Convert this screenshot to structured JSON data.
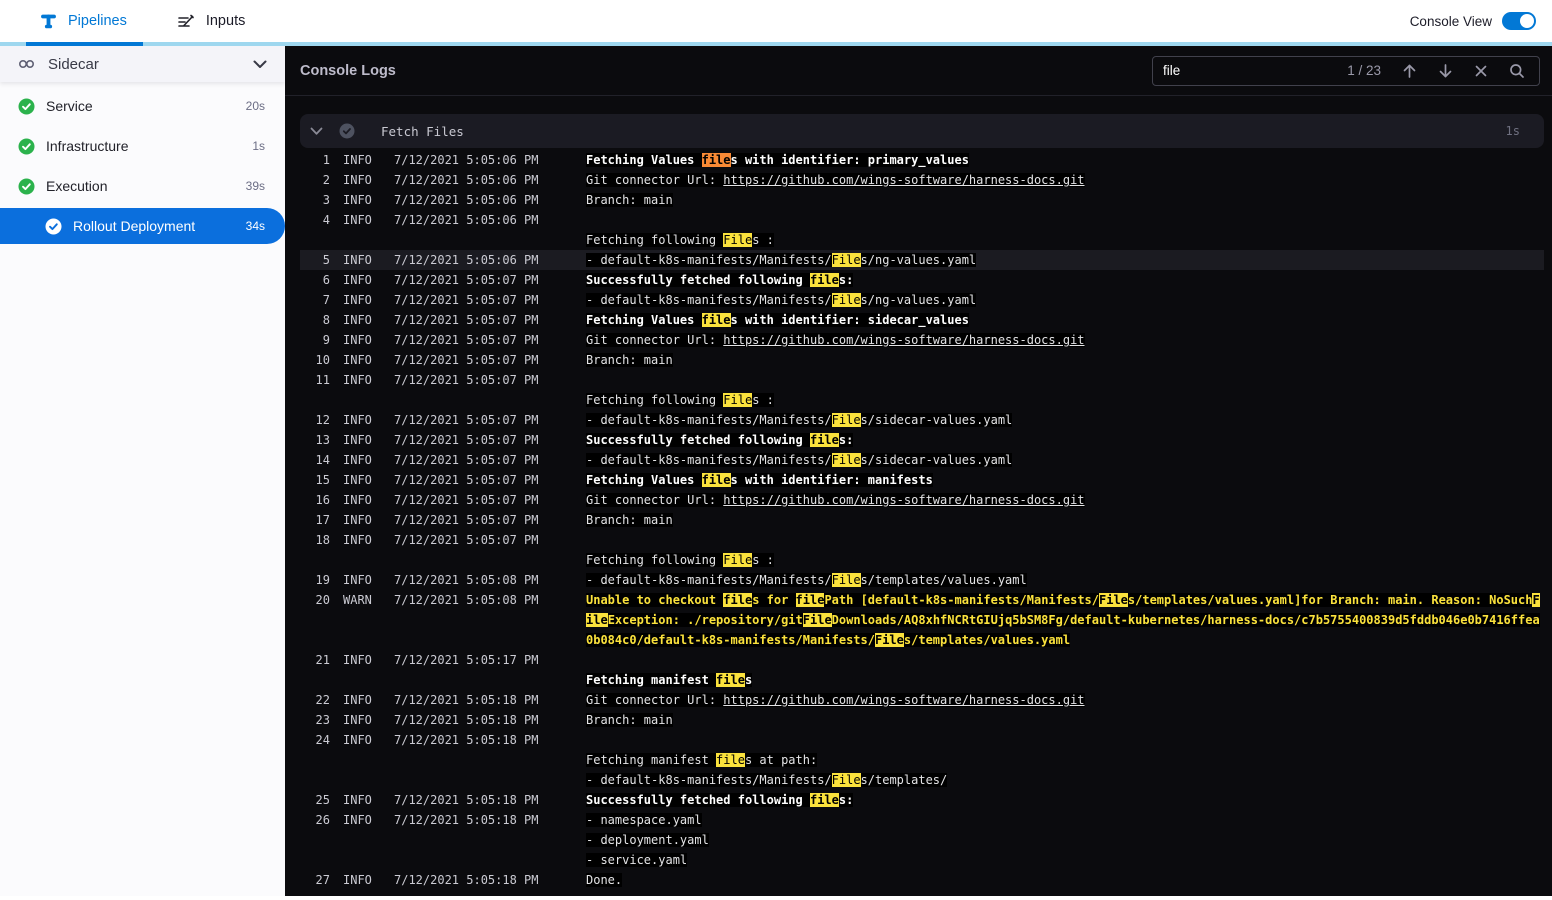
{
  "topbar": {
    "tabs": [
      {
        "label": "Pipelines",
        "active": true
      },
      {
        "label": "Inputs",
        "active": false
      }
    ],
    "console_view_label": "Console View",
    "console_view_on": true
  },
  "sidebar": {
    "stage_label": "Sidecar",
    "steps": [
      {
        "label": "Service",
        "duration": "20s",
        "status": "success",
        "selected": false
      },
      {
        "label": "Infrastructure",
        "duration": "1s",
        "status": "success",
        "selected": false
      },
      {
        "label": "Execution",
        "duration": "39s",
        "status": "success",
        "selected": false
      },
      {
        "label": "Rollout Deployment",
        "duration": "34s",
        "status": "success",
        "selected": true
      }
    ]
  },
  "console": {
    "title": "Console Logs",
    "search": {
      "value": "file",
      "counter": "1 / 23",
      "icons": [
        "arrow-up-icon",
        "arrow-down-icon",
        "close-icon",
        "search-icon"
      ]
    },
    "section": {
      "title": "Fetch Files",
      "duration": "1s"
    },
    "rows": [
      {
        "num": "1",
        "level": "INFO",
        "time": "7/12/2021 5:05:06 PM",
        "bold": true,
        "segs": [
          {
            "t": "Fetching Values "
          },
          {
            "t": "file",
            "h": "o"
          },
          {
            "t": "s with identifier: primary_values"
          }
        ]
      },
      {
        "num": "2",
        "level": "INFO",
        "time": "7/12/2021 5:05:06 PM",
        "segs": [
          {
            "t": "Git connector Url: "
          },
          {
            "t": "https://github.com/wings-software/harness-docs.git",
            "link": true
          }
        ]
      },
      {
        "num": "3",
        "level": "INFO",
        "time": "7/12/2021 5:05:06 PM",
        "segs": [
          {
            "t": "Branch: main"
          }
        ]
      },
      {
        "num": "4",
        "level": "INFO",
        "time": "7/12/2021 5:05:06 PM",
        "segs": []
      },
      {
        "segs": [
          {
            "t": "Fetching following "
          },
          {
            "t": "File",
            "h": "y"
          },
          {
            "t": "s :"
          }
        ]
      },
      {
        "num": "5",
        "level": "INFO",
        "time": "7/12/2021 5:05:06 PM",
        "hl": true,
        "segs": [
          {
            "t": "- default-k8s-manifests/Manifests/"
          },
          {
            "t": "File",
            "h": "y"
          },
          {
            "t": "s/ng-values.yaml"
          }
        ]
      },
      {
        "num": "6",
        "level": "INFO",
        "time": "7/12/2021 5:05:07 PM",
        "bold": true,
        "segs": [
          {
            "t": "Successfully fetched following "
          },
          {
            "t": "file",
            "h": "y"
          },
          {
            "t": "s:"
          }
        ]
      },
      {
        "num": "7",
        "level": "INFO",
        "time": "7/12/2021 5:05:07 PM",
        "segs": [
          {
            "t": "- default-k8s-manifests/Manifests/"
          },
          {
            "t": "File",
            "h": "y"
          },
          {
            "t": "s/ng-values.yaml"
          }
        ]
      },
      {
        "num": "8",
        "level": "INFO",
        "time": "7/12/2021 5:05:07 PM",
        "bold": true,
        "segs": [
          {
            "t": "Fetching Values "
          },
          {
            "t": "file",
            "h": "y"
          },
          {
            "t": "s with identifier: sidecar_values"
          }
        ]
      },
      {
        "num": "9",
        "level": "INFO",
        "time": "7/12/2021 5:05:07 PM",
        "segs": [
          {
            "t": "Git connector Url: "
          },
          {
            "t": "https://github.com/wings-software/harness-docs.git",
            "link": true
          }
        ]
      },
      {
        "num": "10",
        "level": "INFO",
        "time": "7/12/2021 5:05:07 PM",
        "segs": [
          {
            "t": "Branch: main"
          }
        ]
      },
      {
        "num": "11",
        "level": "INFO",
        "time": "7/12/2021 5:05:07 PM",
        "segs": []
      },
      {
        "segs": [
          {
            "t": "Fetching following "
          },
          {
            "t": "File",
            "h": "y"
          },
          {
            "t": "s :"
          }
        ]
      },
      {
        "num": "12",
        "level": "INFO",
        "time": "7/12/2021 5:05:07 PM",
        "segs": [
          {
            "t": "- default-k8s-manifests/Manifests/"
          },
          {
            "t": "File",
            "h": "y"
          },
          {
            "t": "s/sidecar-values.yaml"
          }
        ]
      },
      {
        "num": "13",
        "level": "INFO",
        "time": "7/12/2021 5:05:07 PM",
        "bold": true,
        "segs": [
          {
            "t": "Successfully fetched following "
          },
          {
            "t": "file",
            "h": "y"
          },
          {
            "t": "s:"
          }
        ]
      },
      {
        "num": "14",
        "level": "INFO",
        "time": "7/12/2021 5:05:07 PM",
        "segs": [
          {
            "t": "- default-k8s-manifests/Manifests/"
          },
          {
            "t": "File",
            "h": "y"
          },
          {
            "t": "s/sidecar-values.yaml"
          }
        ]
      },
      {
        "num": "15",
        "level": "INFO",
        "time": "7/12/2021 5:05:07 PM",
        "bold": true,
        "segs": [
          {
            "t": "Fetching Values "
          },
          {
            "t": "file",
            "h": "y"
          },
          {
            "t": "s with identifier: manifests"
          }
        ]
      },
      {
        "num": "16",
        "level": "INFO",
        "time": "7/12/2021 5:05:07 PM",
        "segs": [
          {
            "t": "Git connector Url: "
          },
          {
            "t": "https://github.com/wings-software/harness-docs.git",
            "link": true
          }
        ]
      },
      {
        "num": "17",
        "level": "INFO",
        "time": "7/12/2021 5:05:07 PM",
        "segs": [
          {
            "t": "Branch: main"
          }
        ]
      },
      {
        "num": "18",
        "level": "INFO",
        "time": "7/12/2021 5:05:07 PM",
        "segs": []
      },
      {
        "segs": [
          {
            "t": "Fetching following "
          },
          {
            "t": "File",
            "h": "y"
          },
          {
            "t": "s :"
          }
        ]
      },
      {
        "num": "19",
        "level": "INFO",
        "time": "7/12/2021 5:05:08 PM",
        "segs": [
          {
            "t": "- default-k8s-manifests/Manifests/"
          },
          {
            "t": "File",
            "h": "y"
          },
          {
            "t": "s/templates/values.yaml"
          }
        ]
      },
      {
        "num": "20",
        "level": "WARN",
        "time": "7/12/2021 5:05:08 PM",
        "segs": [
          {
            "t": "Unable to checkout "
          },
          {
            "t": "file",
            "h": "y"
          },
          {
            "t": "s for "
          },
          {
            "t": "file",
            "h": "y"
          },
          {
            "t": "Path [default-k8s-manifests/Manifests/"
          },
          {
            "t": "File",
            "h": "y"
          },
          {
            "t": "s/templates/values.yaml]for Branch: main. Reason: NoSuch"
          },
          {
            "t": "File",
            "h": "y"
          },
          {
            "t": "Exception: ./repository/git"
          },
          {
            "t": "File",
            "h": "y"
          },
          {
            "t": "Downloads/AQ8xhfNCRtGIUjq5bSM8Fg/default-kubernetes/harness-docs/c7b5755400839d5fddb046e0b7416ffea0b084c0/default-k8s-manifests/Manifests/"
          },
          {
            "t": "File",
            "h": "y"
          },
          {
            "t": "s/templates/values.yaml"
          }
        ]
      },
      {
        "num": "21",
        "level": "INFO",
        "time": "7/12/2021 5:05:17 PM",
        "segs": []
      },
      {
        "bold": true,
        "segs": [
          {
            "t": "Fetching manifest "
          },
          {
            "t": "file",
            "h": "y"
          },
          {
            "t": "s"
          }
        ]
      },
      {
        "num": "22",
        "level": "INFO",
        "time": "7/12/2021 5:05:18 PM",
        "segs": [
          {
            "t": "Git connector Url: "
          },
          {
            "t": "https://github.com/wings-software/harness-docs.git",
            "link": true
          }
        ]
      },
      {
        "num": "23",
        "level": "INFO",
        "time": "7/12/2021 5:05:18 PM",
        "segs": [
          {
            "t": "Branch: main"
          }
        ]
      },
      {
        "num": "24",
        "level": "INFO",
        "time": "7/12/2021 5:05:18 PM",
        "segs": []
      },
      {
        "segs": [
          {
            "t": "Fetching manifest "
          },
          {
            "t": "file",
            "h": "y"
          },
          {
            "t": "s at path:"
          }
        ]
      },
      {
        "segs": [
          {
            "t": "- default-k8s-manifests/Manifests/"
          },
          {
            "t": "File",
            "h": "y"
          },
          {
            "t": "s/templates/"
          }
        ]
      },
      {
        "num": "25",
        "level": "INFO",
        "time": "7/12/2021 5:05:18 PM",
        "bold": true,
        "segs": [
          {
            "t": "Successfully fetched following "
          },
          {
            "t": "file",
            "h": "y"
          },
          {
            "t": "s:"
          }
        ]
      },
      {
        "num": "26",
        "level": "INFO",
        "time": "7/12/2021 5:05:18 PM",
        "segs": [
          {
            "t": "- namespace.yaml"
          }
        ]
      },
      {
        "segs": [
          {
            "t": "- deployment.yaml"
          }
        ]
      },
      {
        "segs": [
          {
            "t": "- service.yaml"
          }
        ]
      },
      {
        "num": "27",
        "level": "INFO",
        "time": "7/12/2021 5:05:18 PM",
        "segs": [
          {
            "t": "Done."
          }
        ]
      }
    ]
  },
  "colors": {
    "brand_blue": "#0278D5",
    "selected_step_blue": "#0B6FDD",
    "topbar_accent_cyan": "#9ED7EF",
    "status_green": "#2BB24C",
    "match_current_orange": "#F98A35",
    "match_yellow": "#FBE23C",
    "warn_text_yellow": "#FBE23C",
    "console_bg": "#0B0B0E"
  }
}
